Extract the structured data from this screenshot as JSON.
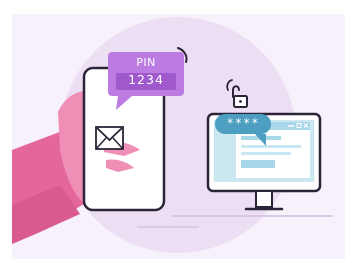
{
  "phone_message": {
    "label": "PIN",
    "code": "1234"
  },
  "computer_login": {
    "masked_password": "****"
  },
  "colors": {
    "background_circle": "#ecdff3",
    "hand": "#f08fb5",
    "sleeve": "#e4679b",
    "phone_body": "#ffffff",
    "outline": "#2c2438",
    "pin_bubble": "#bb7be0",
    "password_bubble": "#4c9fc0",
    "monitor_screen": "#cbe7f2",
    "monitor_window": "#a9d7ea"
  },
  "icons": [
    "envelope-icon",
    "padlock-icon",
    "notification-arc-icon",
    "wifi-arc-icon"
  ]
}
